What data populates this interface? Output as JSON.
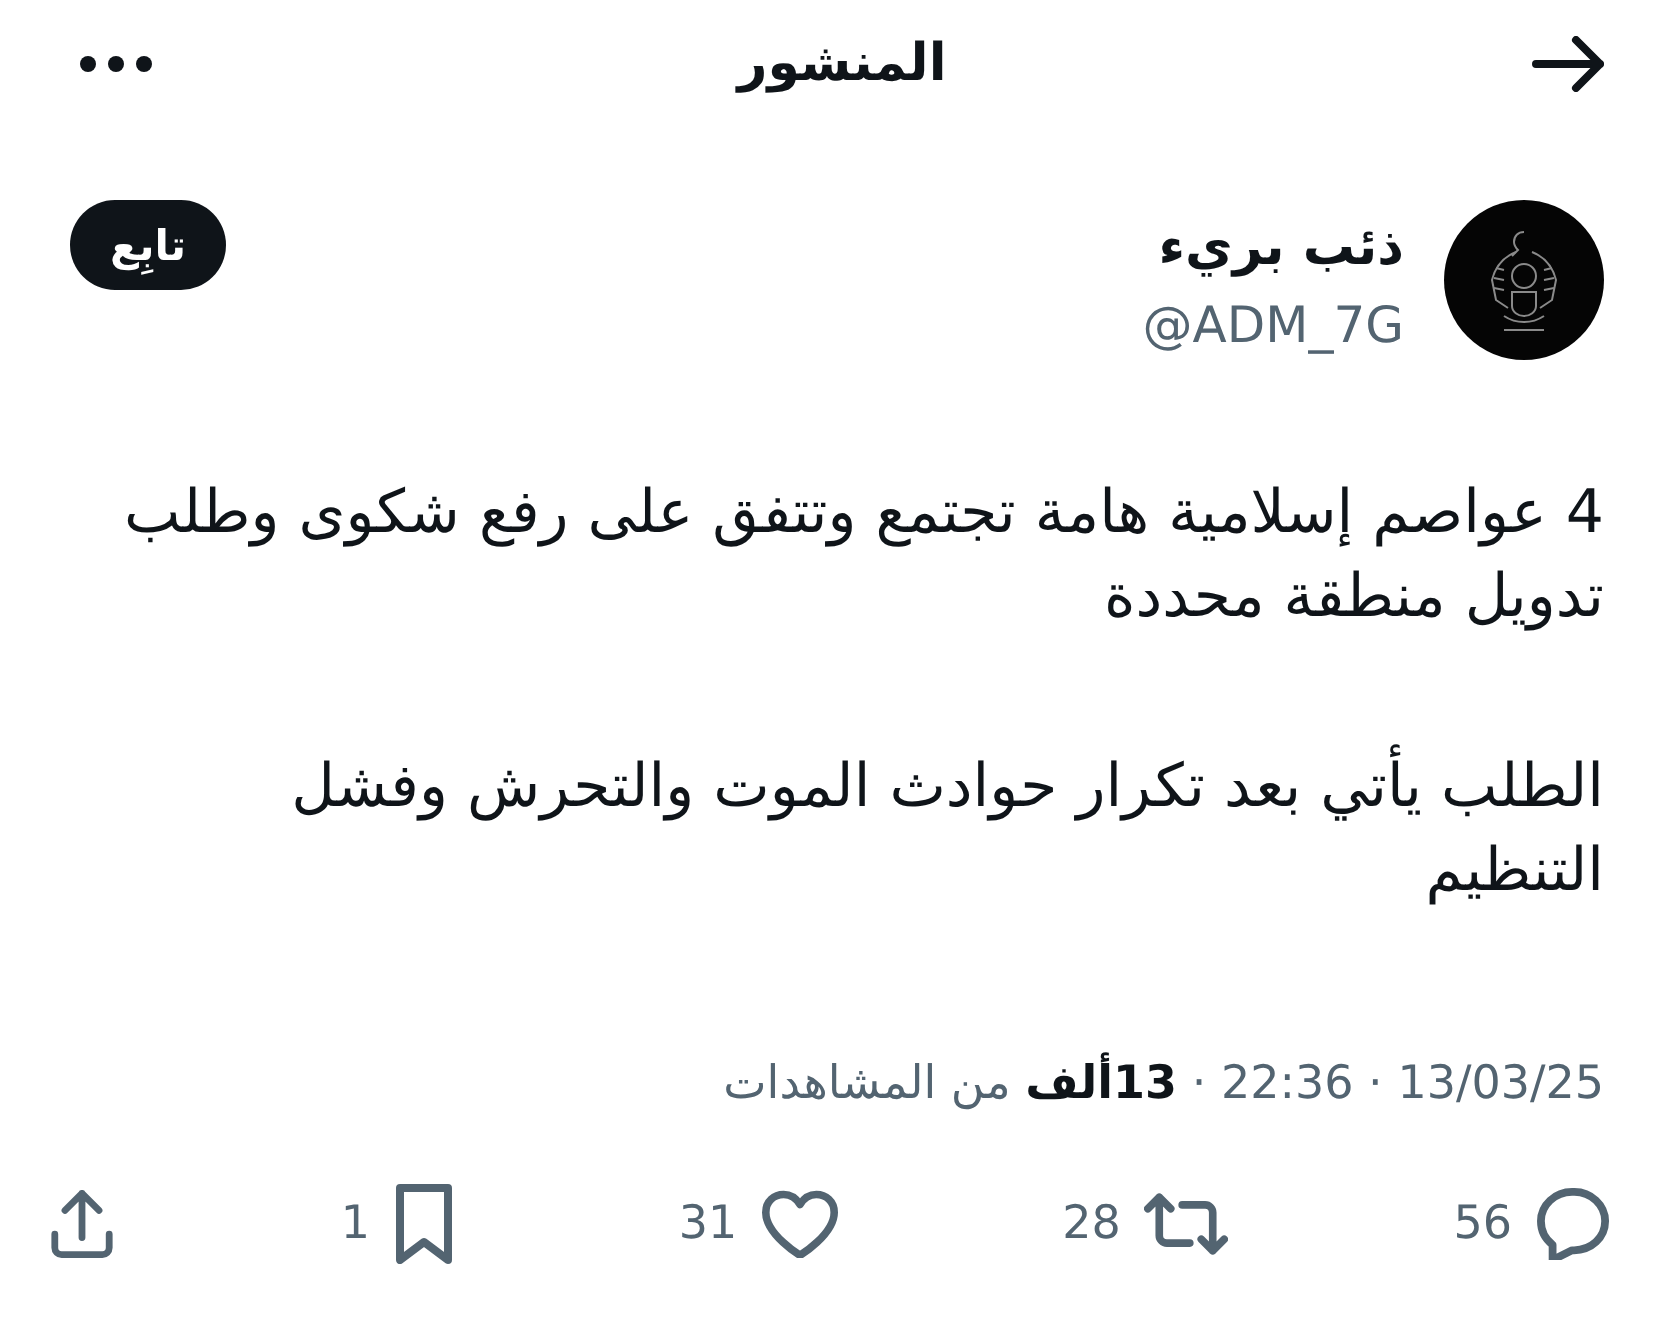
{
  "header": {
    "title": "المنشور"
  },
  "author": {
    "name": "ذئب بريء",
    "handle": "@ADM_7G",
    "follow_button": "تابِع"
  },
  "post": {
    "paragraphs": [
      {
        "lines": [
          "4 عواصم إسلامية هامة تجتمع وتتفق على رفع شكوى وطلب",
          "تدويل منطقة محددة"
        ]
      },
      {
        "lines": [
          "الطلب يأتي بعد تكرار حوادث الموت والتحرش وفشل",
          "التنظيم"
        ]
      }
    ],
    "meta": "13/03/25 · 22:36 · **13ألف** من المشاهدات"
  },
  "actions": [
    {
      "kind": "reply",
      "count": "56"
    },
    {
      "kind": "repost",
      "count": "28"
    },
    {
      "kind": "like",
      "count": "31"
    },
    {
      "kind": "bookmark",
      "count": "1"
    },
    {
      "kind": "share"
    }
  ]
}
